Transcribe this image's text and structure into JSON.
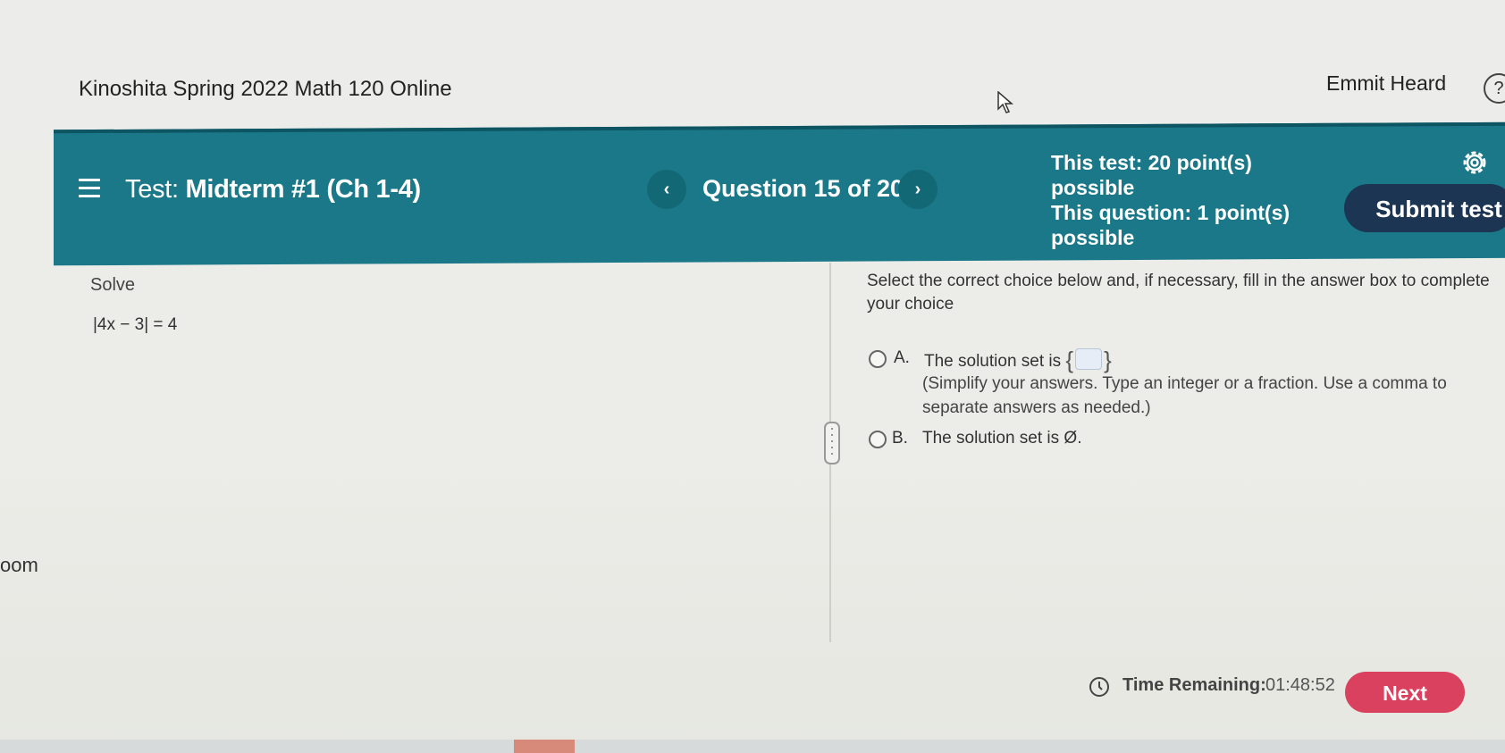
{
  "header": {
    "course_title": "Kinoshita Spring 2022 Math 120 Online",
    "user_name": "Emmit Heard",
    "help_icon": "?"
  },
  "side_fragment": "oom",
  "test_bar": {
    "test_label": "Test:",
    "test_name": "Midterm #1 (Ch 1-4)",
    "prev_icon": "‹",
    "next_icon": "›",
    "question_counter": "Question 15 of 20",
    "test_points": "This test: 20 point(s) possible",
    "question_points": "This question: 1 point(s) possible",
    "submit_label": "Submit test",
    "bar_color": "#1a7889",
    "submit_color": "#1c3552"
  },
  "question": {
    "prompt": "Solve",
    "equation": "|4x − 3| = 4"
  },
  "answer_panel": {
    "instructions": "Select the correct choice below and, if necessary, fill in the answer box to complete your choice",
    "choices": [
      {
        "letter": "A.",
        "text": "The solution set is",
        "open_brace": "{",
        "close_brace": "}",
        "answer_value": "",
        "hint": "(Simplify your answers. Type an integer or a fraction. Use a comma to separate answers as needed.)"
      },
      {
        "letter": "B.",
        "text": "The solution set is Ø."
      }
    ]
  },
  "footer": {
    "time_label": "Time Remaining:",
    "time_value": "01:48:52",
    "next_label": "Next",
    "next_color": "#d9415e"
  }
}
